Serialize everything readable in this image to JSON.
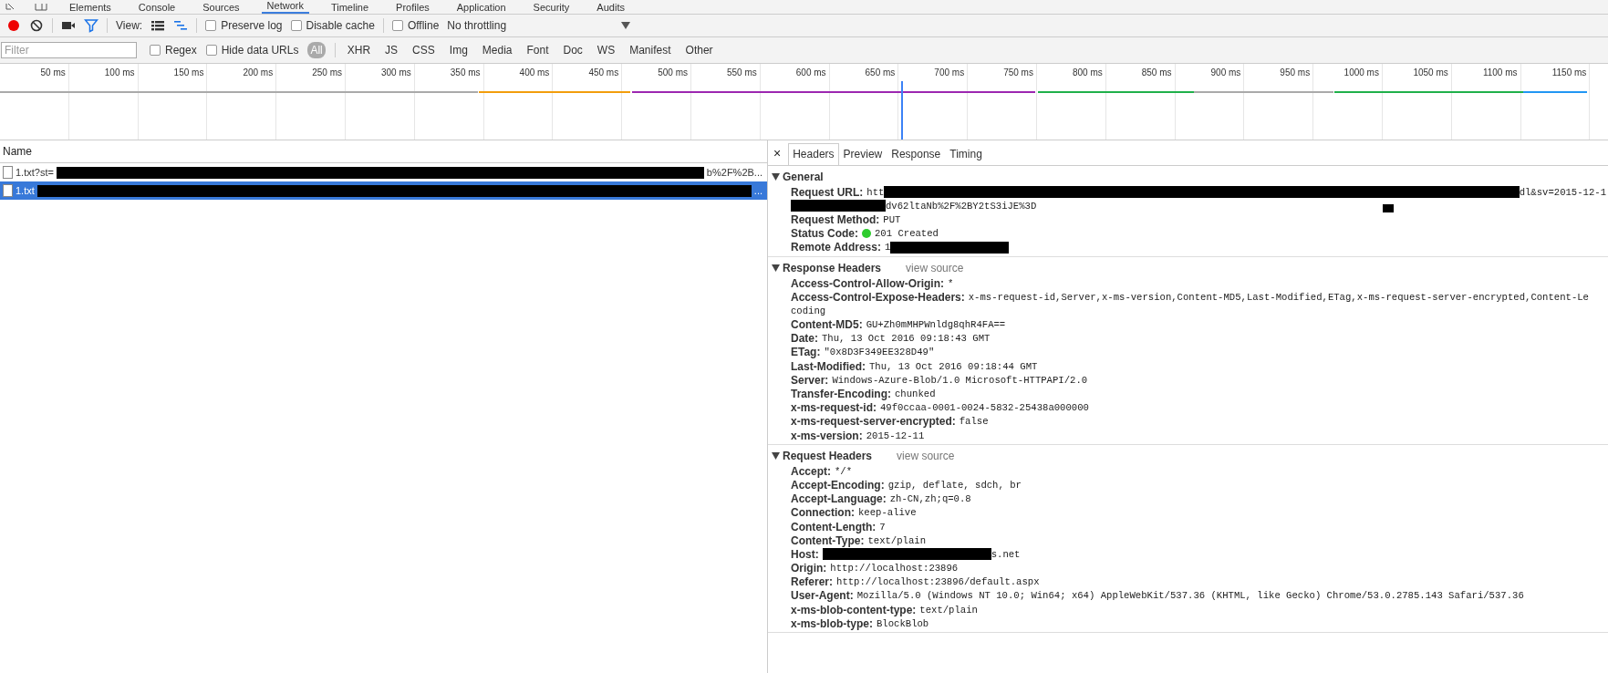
{
  "devtools_tabs": [
    {
      "label": "Elements",
      "selected": false
    },
    {
      "label": "Console",
      "selected": false
    },
    {
      "label": "Sources",
      "selected": false
    },
    {
      "label": "Network",
      "selected": true
    },
    {
      "label": "Timeline",
      "selected": false
    },
    {
      "label": "Profiles",
      "selected": false
    },
    {
      "label": "Application",
      "selected": false
    },
    {
      "label": "Security",
      "selected": false
    },
    {
      "label": "Audits",
      "selected": false
    }
  ],
  "toolbar": {
    "recording": true,
    "filter_active": true,
    "view_label": "View:",
    "large_rows": false,
    "overview": true,
    "checkboxes": [
      {
        "label": "Preserve log",
        "checked": false
      },
      {
        "label": "Disable cache",
        "checked": false
      }
    ],
    "offline": {
      "label": "Offline",
      "checked": false
    },
    "throttling": "No throttling"
  },
  "filter": {
    "placeholder": "Filter",
    "checkboxes": [
      {
        "label": "Regex",
        "checked": false
      },
      {
        "label": "Hide data URLs",
        "checked": false
      }
    ],
    "types": [
      {
        "label": "All",
        "selected": true
      },
      {
        "label": "XHR",
        "selected": false
      },
      {
        "label": "JS",
        "selected": false
      },
      {
        "label": "CSS",
        "selected": false
      },
      {
        "label": "Img",
        "selected": false
      },
      {
        "label": "Media",
        "selected": false
      },
      {
        "label": "Font",
        "selected": false
      },
      {
        "label": "Doc",
        "selected": false
      },
      {
        "label": "WS",
        "selected": false
      },
      {
        "label": "Manifest",
        "selected": false
      },
      {
        "label": "Other",
        "selected": false
      }
    ]
  },
  "timeline": {
    "ticks": [
      "50 ms",
      "100 ms",
      "150 ms",
      "200 ms",
      "250 ms",
      "300 ms",
      "350 ms",
      "400 ms",
      "450 ms",
      "500 ms",
      "550 ms",
      "600 ms",
      "650 ms",
      "700 ms",
      "750 ms",
      "800 ms",
      "850 ms",
      "900 ms",
      "950 ms",
      "1000 ms",
      "1050 ms",
      "1100 ms",
      "1150 ms"
    ]
  },
  "requests": {
    "column": "Name",
    "rows": [
      {
        "selected": false,
        "segments": [
          {
            "kind": "text",
            "text": "1.txt?st="
          },
          {
            "kind": "redacted"
          },
          {
            "kind": "text",
            "text": "b%2F%2B..."
          }
        ]
      },
      {
        "selected": true,
        "segments": [
          {
            "kind": "text",
            "text": "1.txt"
          },
          {
            "kind": "redacted"
          },
          {
            "kind": "text",
            "text": "..."
          }
        ]
      }
    ]
  },
  "details": {
    "close": "×",
    "tabs": [
      {
        "label": "Headers",
        "selected": true
      },
      {
        "label": "Preview",
        "selected": false
      },
      {
        "label": "Response",
        "selected": false
      },
      {
        "label": "Timing",
        "selected": false
      }
    ],
    "sections": [
      {
        "title": "General",
        "expanded": true,
        "rows": [
          {
            "name": "Request URL:",
            "lines": [
              [
                {
                  "kind": "text",
                  "text": "htt"
                },
                {
                  "kind": "redacted"
                },
                {
                  "kind": "text",
                  "text": "dl&sv=2015-12-1"
                }
              ],
              [
                {
                  "kind": "redacted"
                },
                {
                  "kind": "text",
                  "text": "dv62ltaNb%2F%2BY2tS3iJE%3D"
                },
                {
                  "kind": "redacted"
                }
              ]
            ]
          },
          {
            "name": "Request Method:",
            "lines": [
              [
                {
                  "kind": "text",
                  "text": "PUT"
                }
              ]
            ]
          },
          {
            "name": "Status Code:",
            "color": "#2ecc2e",
            "lines": [
              [
                {
                  "kind": "text",
                  "text": "201 Created"
                }
              ]
            ]
          },
          {
            "name": "Remote Address:",
            "lines": [
              [
                {
                  "kind": "text",
                  "text": "1"
                },
                {
                  "kind": "redacted"
                }
              ]
            ]
          }
        ]
      },
      {
        "title": "Response Headers",
        "expanded": true,
        "action": "view source",
        "rows": [
          {
            "name": "Access-Control-Allow-Origin:",
            "lines": [
              [
                {
                  "kind": "text",
                  "text": "*"
                }
              ]
            ]
          },
          {
            "name": "Access-Control-Expose-Headers:",
            "lines": [
              [
                {
                  "kind": "text",
                  "text": "x-ms-request-id,Server,x-ms-version,Content-MD5,Last-Modified,ETag,x-ms-request-server-encrypted,Content-Le"
                }
              ],
              [
                {
                  "kind": "text",
                  "text": "coding"
                }
              ]
            ]
          },
          {
            "name": "Content-MD5:",
            "lines": [
              [
                {
                  "kind": "text",
                  "text": "GU+Zh0mMHPWnldg8qhR4FA=="
                }
              ]
            ]
          },
          {
            "name": "Date:",
            "lines": [
              [
                {
                  "kind": "text",
                  "text": "Thu, 13 Oct 2016 09:18:43 GMT"
                }
              ]
            ]
          },
          {
            "name": "ETag:",
            "lines": [
              [
                {
                  "kind": "text",
                  "text": "\"0x8D3F349EE328D49\""
                }
              ]
            ]
          },
          {
            "name": "Last-Modified:",
            "lines": [
              [
                {
                  "kind": "text",
                  "text": "Thu, 13 Oct 2016 09:18:44 GMT"
                }
              ]
            ]
          },
          {
            "name": "Server:",
            "lines": [
              [
                {
                  "kind": "text",
                  "text": "Windows-Azure-Blob/1.0 Microsoft-HTTPAPI/2.0"
                }
              ]
            ]
          },
          {
            "name": "Transfer-Encoding:",
            "lines": [
              [
                {
                  "kind": "text",
                  "text": "chunked"
                }
              ]
            ]
          },
          {
            "name": "x-ms-request-id:",
            "lines": [
              [
                {
                  "kind": "text",
                  "text": "49f0ccaa-0001-0024-5832-25438a000000"
                }
              ]
            ]
          },
          {
            "name": "x-ms-request-server-encrypted:",
            "lines": [
              [
                {
                  "kind": "text",
                  "text": "false"
                }
              ]
            ]
          },
          {
            "name": "x-ms-version:",
            "lines": [
              [
                {
                  "kind": "text",
                  "text": "2015-12-11"
                }
              ]
            ]
          }
        ]
      },
      {
        "title": "Request Headers",
        "expanded": true,
        "action": "view source",
        "rows": [
          {
            "name": "Accept:",
            "lines": [
              [
                {
                  "kind": "text",
                  "text": "*/*"
                }
              ]
            ]
          },
          {
            "name": "Accept-Encoding:",
            "lines": [
              [
                {
                  "kind": "text",
                  "text": "gzip, deflate, sdch, br"
                }
              ]
            ]
          },
          {
            "name": "Accept-Language:",
            "lines": [
              [
                {
                  "kind": "text",
                  "text": "zh-CN,zh;q=0.8"
                }
              ]
            ]
          },
          {
            "name": "Connection:",
            "lines": [
              [
                {
                  "kind": "text",
                  "text": "keep-alive"
                }
              ]
            ]
          },
          {
            "name": "Content-Length:",
            "lines": [
              [
                {
                  "kind": "text",
                  "text": "7"
                }
              ]
            ]
          },
          {
            "name": "Content-Type:",
            "lines": [
              [
                {
                  "kind": "text",
                  "text": "text/plain"
                }
              ]
            ]
          },
          {
            "name": "Host:",
            "lines": [
              [
                {
                  "kind": "redacted"
                },
                {
                  "kind": "text",
                  "text": "s.net"
                }
              ]
            ]
          },
          {
            "name": "Origin:",
            "lines": [
              [
                {
                  "kind": "text",
                  "text": "http://localhost:23896"
                }
              ]
            ]
          },
          {
            "name": "Referer:",
            "lines": [
              [
                {
                  "kind": "text",
                  "text": "http://localhost:23896/default.aspx"
                }
              ]
            ]
          },
          {
            "name": "User-Agent:",
            "lines": [
              [
                {
                  "kind": "text",
                  "text": "Mozilla/5.0 (Windows NT 10.0; Win64; x64) AppleWebKit/537.36 (KHTML, like Gecko) Chrome/53.0.2785.143 Safari/537.36"
                }
              ]
            ]
          },
          {
            "name": "x-ms-blob-content-type:",
            "lines": [
              [
                {
                  "kind": "text",
                  "text": "text/plain"
                }
              ]
            ]
          },
          {
            "name": "x-ms-blob-type:",
            "lines": [
              [
                {
                  "kind": "text",
                  "text": "BlockBlob"
                }
              ]
            ]
          }
        ]
      }
    ]
  }
}
